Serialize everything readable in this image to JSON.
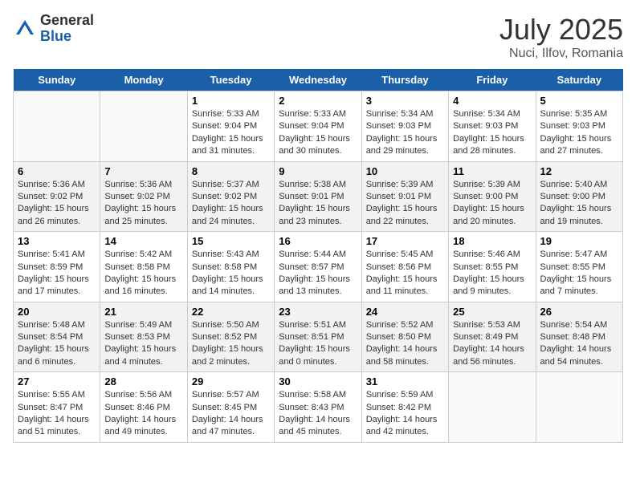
{
  "header": {
    "logo_general": "General",
    "logo_blue": "Blue",
    "title": "July 2025",
    "subtitle": "Nuci, Ilfov, Romania"
  },
  "days_of_week": [
    "Sunday",
    "Monday",
    "Tuesday",
    "Wednesday",
    "Thursday",
    "Friday",
    "Saturday"
  ],
  "weeks": [
    {
      "shaded": false,
      "days": [
        {
          "num": "",
          "sunrise": "",
          "sunset": "",
          "daylight": ""
        },
        {
          "num": "",
          "sunrise": "",
          "sunset": "",
          "daylight": ""
        },
        {
          "num": "1",
          "sunrise": "Sunrise: 5:33 AM",
          "sunset": "Sunset: 9:04 PM",
          "daylight": "Daylight: 15 hours and 31 minutes."
        },
        {
          "num": "2",
          "sunrise": "Sunrise: 5:33 AM",
          "sunset": "Sunset: 9:04 PM",
          "daylight": "Daylight: 15 hours and 30 minutes."
        },
        {
          "num": "3",
          "sunrise": "Sunrise: 5:34 AM",
          "sunset": "Sunset: 9:03 PM",
          "daylight": "Daylight: 15 hours and 29 minutes."
        },
        {
          "num": "4",
          "sunrise": "Sunrise: 5:34 AM",
          "sunset": "Sunset: 9:03 PM",
          "daylight": "Daylight: 15 hours and 28 minutes."
        },
        {
          "num": "5",
          "sunrise": "Sunrise: 5:35 AM",
          "sunset": "Sunset: 9:03 PM",
          "daylight": "Daylight: 15 hours and 27 minutes."
        }
      ]
    },
    {
      "shaded": true,
      "days": [
        {
          "num": "6",
          "sunrise": "Sunrise: 5:36 AM",
          "sunset": "Sunset: 9:02 PM",
          "daylight": "Daylight: 15 hours and 26 minutes."
        },
        {
          "num": "7",
          "sunrise": "Sunrise: 5:36 AM",
          "sunset": "Sunset: 9:02 PM",
          "daylight": "Daylight: 15 hours and 25 minutes."
        },
        {
          "num": "8",
          "sunrise": "Sunrise: 5:37 AM",
          "sunset": "Sunset: 9:02 PM",
          "daylight": "Daylight: 15 hours and 24 minutes."
        },
        {
          "num": "9",
          "sunrise": "Sunrise: 5:38 AM",
          "sunset": "Sunset: 9:01 PM",
          "daylight": "Daylight: 15 hours and 23 minutes."
        },
        {
          "num": "10",
          "sunrise": "Sunrise: 5:39 AM",
          "sunset": "Sunset: 9:01 PM",
          "daylight": "Daylight: 15 hours and 22 minutes."
        },
        {
          "num": "11",
          "sunrise": "Sunrise: 5:39 AM",
          "sunset": "Sunset: 9:00 PM",
          "daylight": "Daylight: 15 hours and 20 minutes."
        },
        {
          "num": "12",
          "sunrise": "Sunrise: 5:40 AM",
          "sunset": "Sunset: 9:00 PM",
          "daylight": "Daylight: 15 hours and 19 minutes."
        }
      ]
    },
    {
      "shaded": false,
      "days": [
        {
          "num": "13",
          "sunrise": "Sunrise: 5:41 AM",
          "sunset": "Sunset: 8:59 PM",
          "daylight": "Daylight: 15 hours and 17 minutes."
        },
        {
          "num": "14",
          "sunrise": "Sunrise: 5:42 AM",
          "sunset": "Sunset: 8:58 PM",
          "daylight": "Daylight: 15 hours and 16 minutes."
        },
        {
          "num": "15",
          "sunrise": "Sunrise: 5:43 AM",
          "sunset": "Sunset: 8:58 PM",
          "daylight": "Daylight: 15 hours and 14 minutes."
        },
        {
          "num": "16",
          "sunrise": "Sunrise: 5:44 AM",
          "sunset": "Sunset: 8:57 PM",
          "daylight": "Daylight: 15 hours and 13 minutes."
        },
        {
          "num": "17",
          "sunrise": "Sunrise: 5:45 AM",
          "sunset": "Sunset: 8:56 PM",
          "daylight": "Daylight: 15 hours and 11 minutes."
        },
        {
          "num": "18",
          "sunrise": "Sunrise: 5:46 AM",
          "sunset": "Sunset: 8:55 PM",
          "daylight": "Daylight: 15 hours and 9 minutes."
        },
        {
          "num": "19",
          "sunrise": "Sunrise: 5:47 AM",
          "sunset": "Sunset: 8:55 PM",
          "daylight": "Daylight: 15 hours and 7 minutes."
        }
      ]
    },
    {
      "shaded": true,
      "days": [
        {
          "num": "20",
          "sunrise": "Sunrise: 5:48 AM",
          "sunset": "Sunset: 8:54 PM",
          "daylight": "Daylight: 15 hours and 6 minutes."
        },
        {
          "num": "21",
          "sunrise": "Sunrise: 5:49 AM",
          "sunset": "Sunset: 8:53 PM",
          "daylight": "Daylight: 15 hours and 4 minutes."
        },
        {
          "num": "22",
          "sunrise": "Sunrise: 5:50 AM",
          "sunset": "Sunset: 8:52 PM",
          "daylight": "Daylight: 15 hours and 2 minutes."
        },
        {
          "num": "23",
          "sunrise": "Sunrise: 5:51 AM",
          "sunset": "Sunset: 8:51 PM",
          "daylight": "Daylight: 15 hours and 0 minutes."
        },
        {
          "num": "24",
          "sunrise": "Sunrise: 5:52 AM",
          "sunset": "Sunset: 8:50 PM",
          "daylight": "Daylight: 14 hours and 58 minutes."
        },
        {
          "num": "25",
          "sunrise": "Sunrise: 5:53 AM",
          "sunset": "Sunset: 8:49 PM",
          "daylight": "Daylight: 14 hours and 56 minutes."
        },
        {
          "num": "26",
          "sunrise": "Sunrise: 5:54 AM",
          "sunset": "Sunset: 8:48 PM",
          "daylight": "Daylight: 14 hours and 54 minutes."
        }
      ]
    },
    {
      "shaded": false,
      "days": [
        {
          "num": "27",
          "sunrise": "Sunrise: 5:55 AM",
          "sunset": "Sunset: 8:47 PM",
          "daylight": "Daylight: 14 hours and 51 minutes."
        },
        {
          "num": "28",
          "sunrise": "Sunrise: 5:56 AM",
          "sunset": "Sunset: 8:46 PM",
          "daylight": "Daylight: 14 hours and 49 minutes."
        },
        {
          "num": "29",
          "sunrise": "Sunrise: 5:57 AM",
          "sunset": "Sunset: 8:45 PM",
          "daylight": "Daylight: 14 hours and 47 minutes."
        },
        {
          "num": "30",
          "sunrise": "Sunrise: 5:58 AM",
          "sunset": "Sunset: 8:43 PM",
          "daylight": "Daylight: 14 hours and 45 minutes."
        },
        {
          "num": "31",
          "sunrise": "Sunrise: 5:59 AM",
          "sunset": "Sunset: 8:42 PM",
          "daylight": "Daylight: 14 hours and 42 minutes."
        },
        {
          "num": "",
          "sunrise": "",
          "sunset": "",
          "daylight": ""
        },
        {
          "num": "",
          "sunrise": "",
          "sunset": "",
          "daylight": ""
        }
      ]
    }
  ]
}
